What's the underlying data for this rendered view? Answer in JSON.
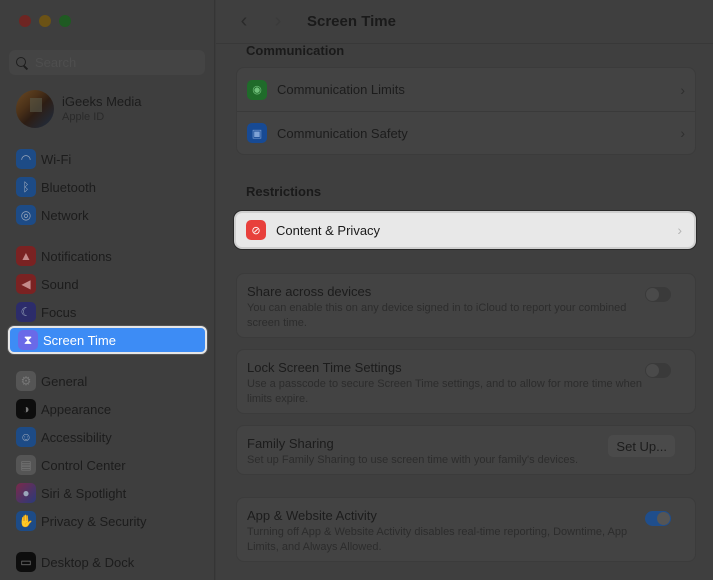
{
  "window": {
    "controls": [
      "close",
      "minimize",
      "zoom"
    ]
  },
  "sidebar": {
    "search": {
      "placeholder": "Search",
      "value": ""
    },
    "account": {
      "name": "iGeeks Media",
      "subtitle": "Apple ID"
    },
    "groups": [
      [
        {
          "label": "Wi-Fi",
          "icon": "wifi-icon",
          "glyph": "◠"
        },
        {
          "label": "Bluetooth",
          "icon": "bluetooth-icon",
          "glyph": "ᛒ"
        },
        {
          "label": "Network",
          "icon": "globe-icon",
          "glyph": "◎"
        }
      ],
      [
        {
          "label": "Notifications",
          "icon": "bell-icon",
          "glyph": "▲"
        },
        {
          "label": "Sound",
          "icon": "speaker-icon",
          "glyph": "◀"
        },
        {
          "label": "Focus",
          "icon": "moon-icon",
          "glyph": "☾"
        },
        {
          "label": "Screen Time",
          "icon": "hourglass-icon",
          "glyph": "⧗",
          "active": true
        }
      ],
      [
        {
          "label": "General",
          "icon": "gear-icon",
          "glyph": "⚙"
        },
        {
          "label": "Appearance",
          "icon": "appearance-icon",
          "glyph": "◑"
        },
        {
          "label": "Accessibility",
          "icon": "accessibility-icon",
          "glyph": "☺"
        },
        {
          "label": "Control Center",
          "icon": "control-center-icon",
          "glyph": "▤"
        },
        {
          "label": "Siri & Spotlight",
          "icon": "siri-icon",
          "glyph": "●"
        },
        {
          "label": "Privacy & Security",
          "icon": "hand-icon",
          "glyph": "✋"
        }
      ],
      [
        {
          "label": "Desktop & Dock",
          "icon": "dock-icon",
          "glyph": "▭"
        }
      ]
    ]
  },
  "main": {
    "title": "Screen Time",
    "communication": {
      "header": "Communication",
      "items": [
        {
          "label": "Communication Limits",
          "icon": "person-circle-icon"
        },
        {
          "label": "Communication Safety",
          "icon": "chat-bubbles-icon"
        }
      ]
    },
    "restrictions": {
      "header": "Restrictions",
      "item": {
        "label": "Content & Privacy",
        "icon": "restricted-icon"
      }
    },
    "settings": [
      {
        "title": "Share across devices",
        "description": "You can enable this on any device signed in to iCloud to report your combined screen time.",
        "control": "toggle",
        "on": false
      },
      {
        "title": "Lock Screen Time Settings",
        "description": "Use a passcode to secure Screen Time settings, and to allow for more time when limits expire.",
        "control": "toggle",
        "on": false
      },
      {
        "title": "Family Sharing",
        "description": "Set up Family Sharing to use screen time with your family's devices.",
        "control": "button",
        "button_label": "Set Up..."
      },
      {
        "title": "App & Website Activity",
        "description": "Turning off App & Website Activity disables real-time reporting, Downtime, App Limits, and Always Allowed.",
        "control": "toggle",
        "on": true
      }
    ]
  },
  "colors": {
    "accent": "#3d8cf5",
    "highlight_row": "#e8e8e8",
    "restricted_icon": "#e8403c",
    "communication_limits_icon": "#2e8b3a",
    "communication_safety_icon": "#1f5cb8"
  }
}
